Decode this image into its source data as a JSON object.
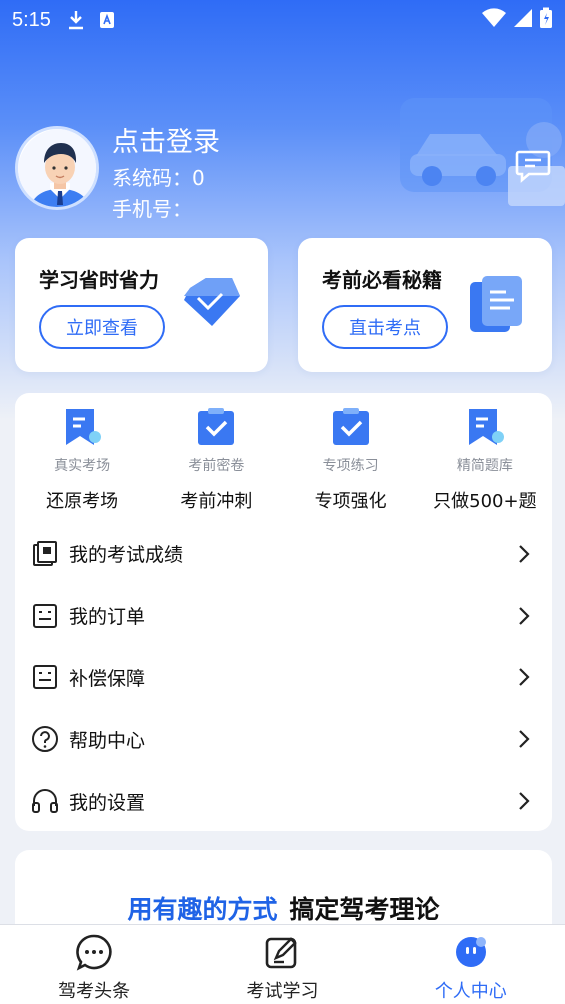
{
  "status_bar": {
    "time": "5:15"
  },
  "profile": {
    "login_title": "点击登录",
    "sys_code": "系统码：0",
    "phone": "手机号："
  },
  "promo": {
    "left": {
      "title": "学习省时省力",
      "button": "立即查看"
    },
    "right": {
      "title": "考前必看秘籍",
      "button": "直击考点"
    }
  },
  "quick_items": [
    {
      "sub": "真实考场",
      "label": "还原考场",
      "icon": "bookmark-icon"
    },
    {
      "sub": "考前密卷",
      "label": "考前冲刺",
      "icon": "clipboard-check-icon"
    },
    {
      "sub": "专项练习",
      "label": "专项强化",
      "icon": "clipboard-check-icon"
    },
    {
      "sub": "精简题库",
      "label": "只做500+题",
      "icon": "bookmark-icon"
    }
  ],
  "menu": [
    {
      "label": "我的考试成绩",
      "icon": "scores-icon"
    },
    {
      "label": "我的订单",
      "icon": "order-icon"
    },
    {
      "label": "补偿保障",
      "icon": "guarantee-icon"
    },
    {
      "label": "帮助中心",
      "icon": "help-icon"
    },
    {
      "label": "我的设置",
      "icon": "headset-icon"
    }
  ],
  "banner": {
    "blue": "用有趣的方式",
    "black": "搞定驾考理论"
  },
  "tabs": [
    {
      "label": "驾考头条",
      "icon": "chat-icon",
      "active": false
    },
    {
      "label": "考试学习",
      "icon": "edit-icon",
      "active": false
    },
    {
      "label": "个人中心",
      "icon": "profile-icon",
      "active": true
    }
  ],
  "colors": {
    "accent": "#2f6cf6",
    "text": "#111111",
    "muted": "#8a8f99"
  }
}
